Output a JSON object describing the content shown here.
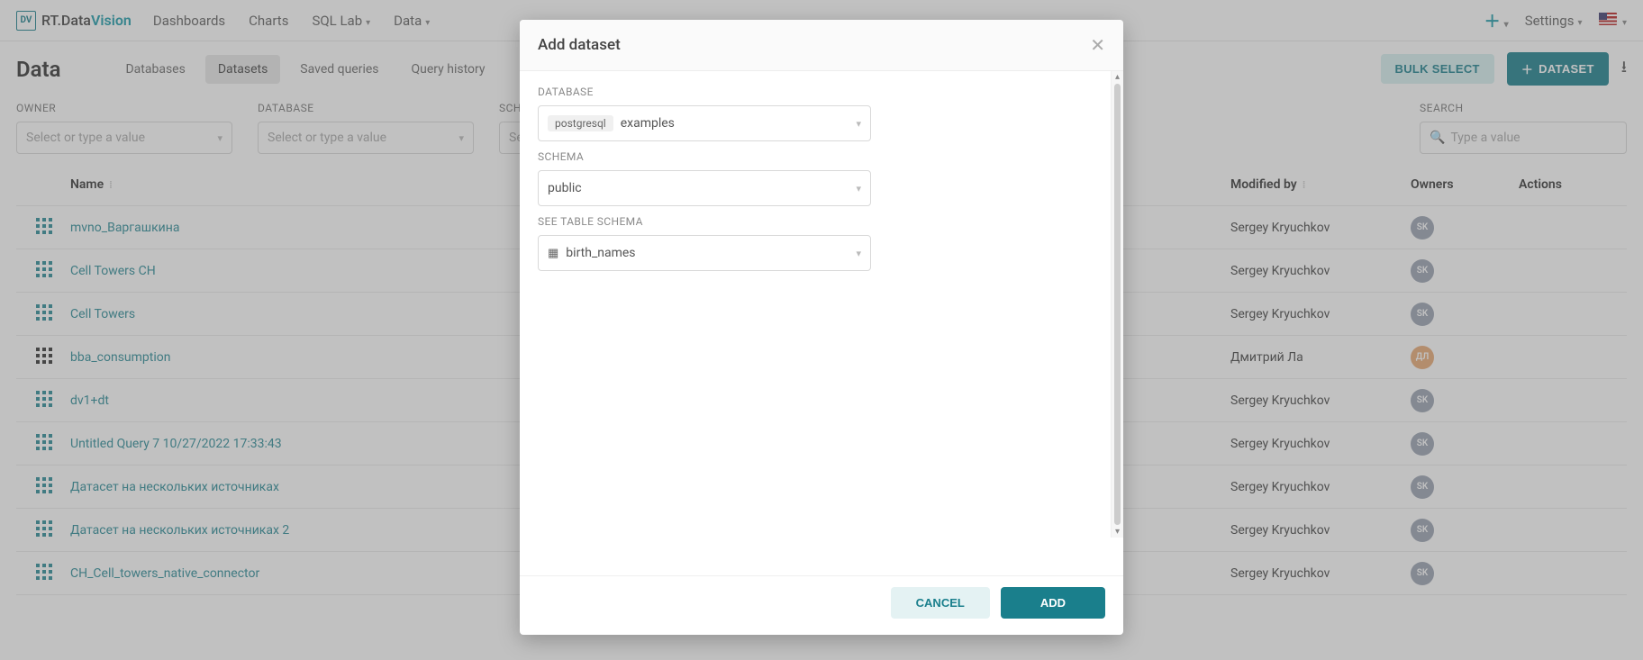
{
  "brand": {
    "prefix": "RT.Data",
    "accent": "Vision",
    "logo": "DV"
  },
  "nav": {
    "dashboards": "Dashboards",
    "charts": "Charts",
    "sql_lab": "SQL Lab",
    "data": "Data",
    "settings": "Settings"
  },
  "page": {
    "title": "Data"
  },
  "tabs": {
    "databases": "Databases",
    "datasets": "Datasets",
    "saved_queries": "Saved queries",
    "query_history": "Query history"
  },
  "actions": {
    "bulk_select": "BULK SELECT",
    "add_dataset": "DATASET"
  },
  "filters": {
    "owner": {
      "label": "OWNER",
      "placeholder": "Select or type a value"
    },
    "database": {
      "label": "DATABASE",
      "placeholder": "Select or type a value"
    },
    "schema": {
      "label": "SCHEMA",
      "placeholder": "Select or type a value"
    },
    "search": {
      "label": "SEARCH",
      "placeholder": "Type a value"
    }
  },
  "table": {
    "headers": {
      "name": "Name",
      "modified_by": "Modified by",
      "owners": "Owners",
      "actions": "Actions"
    },
    "rows": [
      {
        "name": "mvno_Варгашкина",
        "modified_by": "Sergey Kryuchkov",
        "avatar": "SK",
        "avatar_color": "grey",
        "virtual": true
      },
      {
        "name": "Cell Towers CH",
        "modified_by": "Sergey Kryuchkov",
        "avatar": "SK",
        "avatar_color": "grey",
        "virtual": true
      },
      {
        "name": "Cell Towers",
        "modified_by": "Sergey Kryuchkov",
        "avatar": "SK",
        "avatar_color": "grey",
        "virtual": true
      },
      {
        "name": "bba_consumption",
        "modified_by": "Дмитрий Ла",
        "avatar": "ДЛ",
        "avatar_color": "orange",
        "virtual": false
      },
      {
        "name": "dv1+dt",
        "modified_by": "Sergey Kryuchkov",
        "avatar": "SK",
        "avatar_color": "grey",
        "virtual": true
      },
      {
        "name": "Untitled Query 7 10/27/2022 17:33:43",
        "modified_by": "Sergey Kryuchkov",
        "avatar": "SK",
        "avatar_color": "grey",
        "virtual": true
      },
      {
        "name": "Датасет на нескольких источниках",
        "modified_by": "Sergey Kryuchkov",
        "avatar": "SK",
        "avatar_color": "grey",
        "virtual": true
      },
      {
        "name": "Датасет на нескольких источниках 2",
        "modified_by": "Sergey Kryuchkov",
        "avatar": "SK",
        "avatar_color": "grey",
        "virtual": true
      },
      {
        "name": "CH_Cell_towers_native_connector",
        "modified_by": "Sergey Kryuchkov",
        "avatar": "SK",
        "avatar_color": "grey",
        "virtual": true
      }
    ]
  },
  "modal": {
    "title": "Add dataset",
    "labels": {
      "database": "DATABASE",
      "schema": "SCHEMA",
      "table": "SEE TABLE SCHEMA"
    },
    "database": {
      "engine_tag": "postgresql",
      "value": "examples"
    },
    "schema": {
      "value": "public"
    },
    "table": {
      "value": "birth_names"
    },
    "buttons": {
      "cancel": "CANCEL",
      "add": "ADD"
    }
  }
}
